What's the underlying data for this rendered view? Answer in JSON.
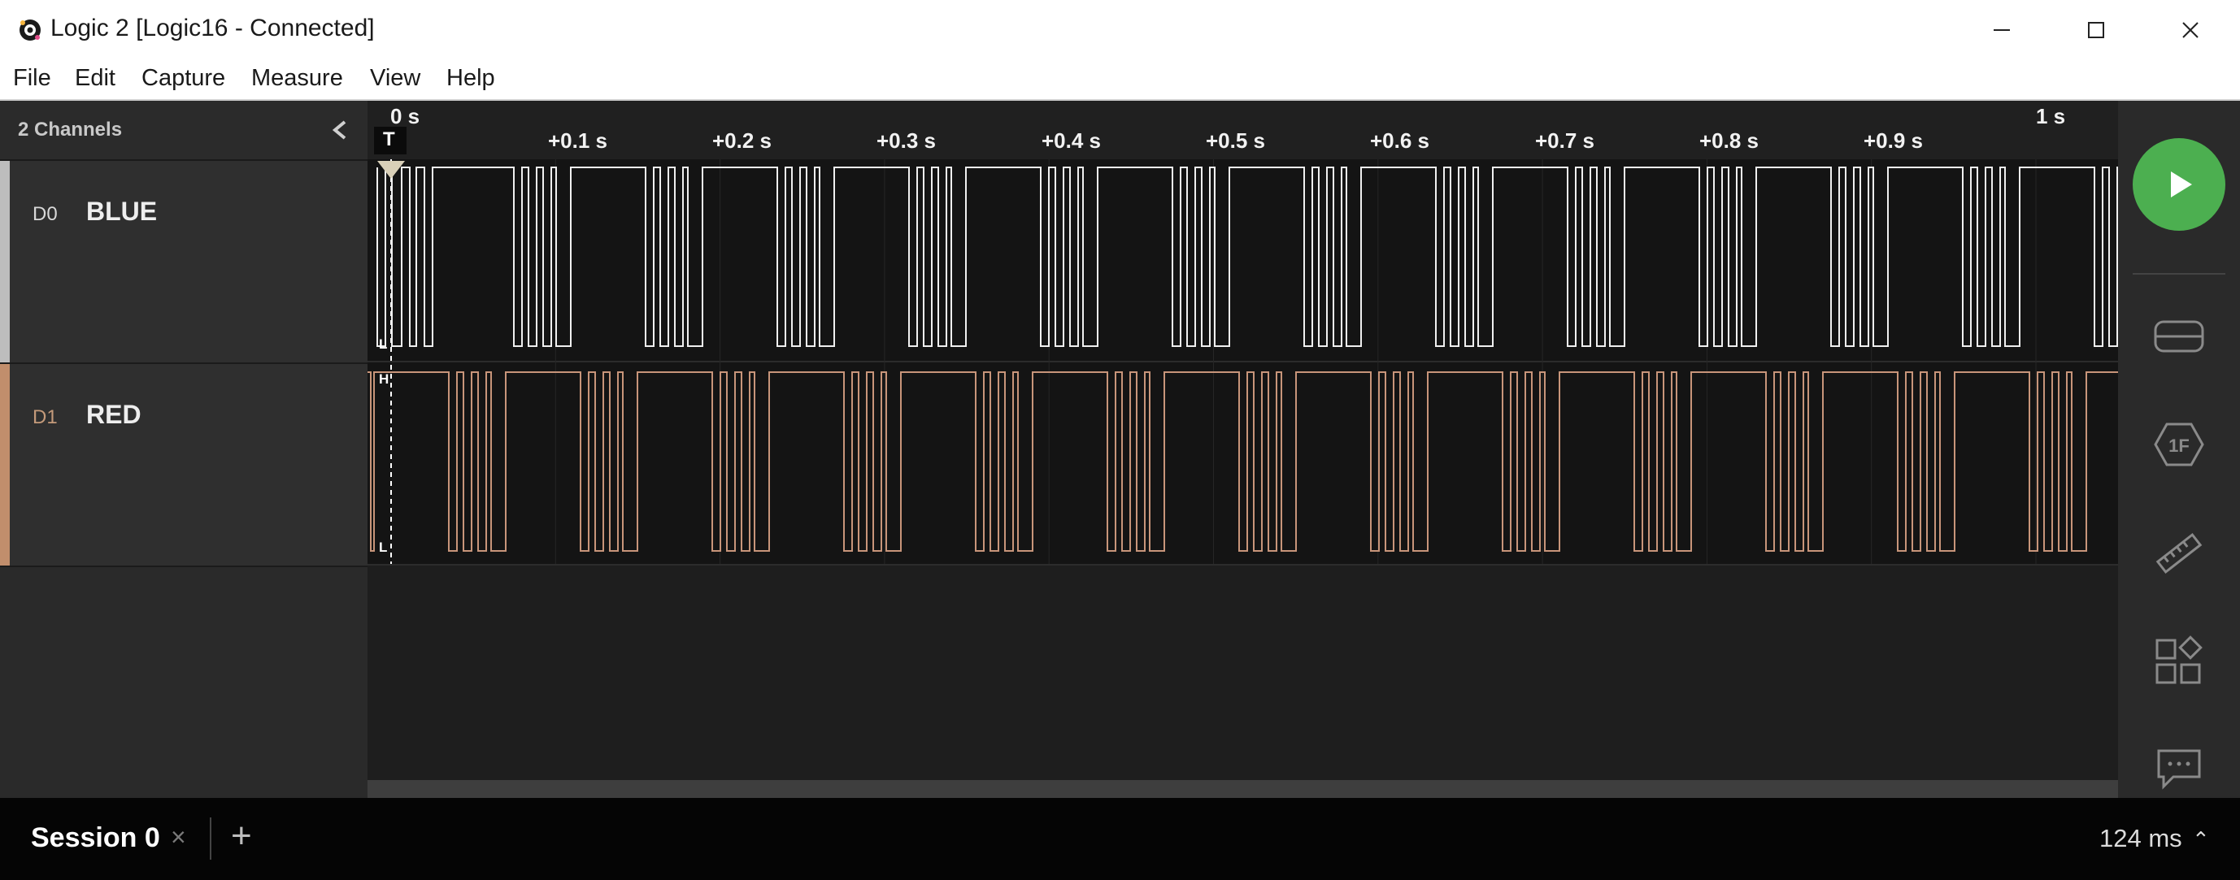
{
  "window": {
    "title": "Logic 2 [Logic16 - Connected]",
    "icon": "logic-app-icon",
    "controls": [
      "minimize-icon",
      "maximize-icon",
      "close-icon"
    ]
  },
  "menu": {
    "items": [
      "File",
      "Edit",
      "Capture",
      "Measure",
      "View",
      "Help"
    ]
  },
  "channels_panel": {
    "header": "2 Channels",
    "collapse_icon": "chevron-left-icon",
    "channels": [
      {
        "id": "D0",
        "name": "BLUE",
        "id_color": "#d8d8d8",
        "name_color": "#eeeeee",
        "stripe_color": "#bdbdbd",
        "wave_color": "#f0f0f0"
      },
      {
        "id": "D1",
        "name": "RED",
        "id_color": "#c49a7a",
        "name_color": "#eeeeee",
        "stripe_color": "#c18e6c",
        "wave_color": "#c8957a"
      }
    ]
  },
  "timeline": {
    "ticks": [
      "0 s",
      "+0.1 s",
      "+0.2 s",
      "+0.3 s",
      "+0.4 s",
      "+0.5 s",
      "+0.6 s",
      "+0.7 s",
      "+0.8 s",
      "+0.9 s",
      "1 s"
    ],
    "trigger_marker": "T",
    "level_high": "H",
    "level_low": "L"
  },
  "sidebar": {
    "buttons": [
      "play-icon",
      "device-icon",
      "analyzer-icon",
      "measure-ruler-icon",
      "extensions-icon",
      "feedback-icon"
    ]
  },
  "status": {
    "session_label": "Session 0",
    "session_close": "×",
    "add_session": "+",
    "duration": "124 ms",
    "duration_icon": "chevron-up-icon"
  }
}
